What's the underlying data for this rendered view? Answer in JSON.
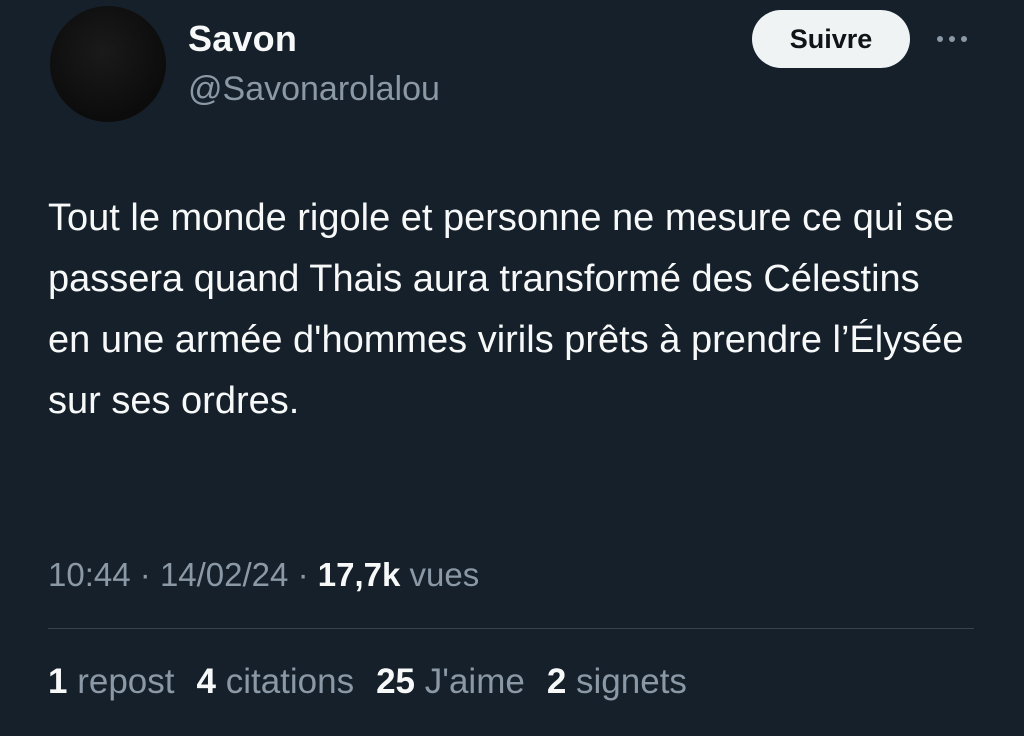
{
  "author": {
    "display_name": "Savon",
    "handle": "@Savonarolalou"
  },
  "actions": {
    "follow_label": "Suivre",
    "more_icon": "more-horizontal-icon"
  },
  "tweet": {
    "text": "Tout le monde rigole et personne ne mesure ce qui se passera quand Thais aura transformé des Célestins en une armée d'hommes virils prêts à prendre l’Élysée sur ses ordres."
  },
  "meta": {
    "time": "10:44",
    "separator": "·",
    "date": "14/02/24",
    "views_count": "17,7k",
    "views_label": "vues"
  },
  "stats": {
    "reposts": {
      "count": "1",
      "label": "repost"
    },
    "quotes": {
      "count": "4",
      "label": "citations"
    },
    "likes": {
      "count": "25",
      "label": "J'aime"
    },
    "bookmarks": {
      "count": "2",
      "label": "signets"
    }
  },
  "colors": {
    "background": "#15202b",
    "primary_text": "#f7f9f9",
    "secondary_text": "#8b98a5",
    "follow_button_bg": "#eff3f4",
    "divider": "#38444d"
  }
}
